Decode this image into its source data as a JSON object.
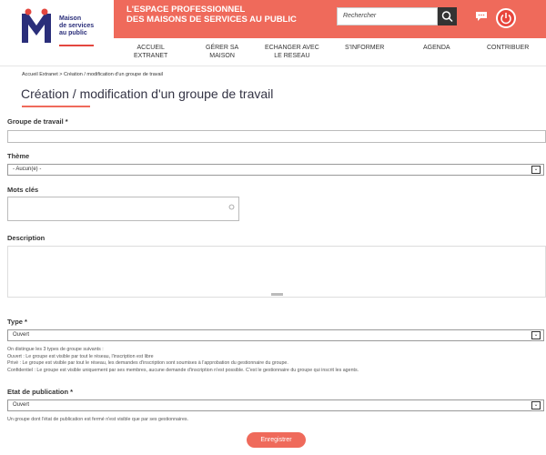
{
  "logo": {
    "lines": [
      "Maison",
      "de services",
      "au public"
    ]
  },
  "banner": {
    "title_line1": "L'ESPACE PROFESSIONNEL",
    "title_line2": "DES MAISONS DE SERVICES AU PUBLIC"
  },
  "search": {
    "placeholder": "Rechercher"
  },
  "nav": {
    "items": [
      {
        "line1": "ACCUEIL",
        "line2": "EXTRANET"
      },
      {
        "line1": "GÉRER SA",
        "line2": "MAISON"
      },
      {
        "line1": "ECHANGER AVEC",
        "line2": "LE RESEAU"
      },
      {
        "line1": "S'INFORMER",
        "line2": ""
      },
      {
        "line1": "AGENDA",
        "line2": ""
      },
      {
        "line1": "CONTRIBUER",
        "line2": ""
      }
    ]
  },
  "breadcrumb": {
    "home": "Accueil Extranet",
    "sep": " > ",
    "current": "Création / modification d'un groupe de travail"
  },
  "page": {
    "title": "Création / modification d'un groupe de travail"
  },
  "form": {
    "group_label": "Groupe de travail *",
    "group_value": "",
    "theme_label": "Thème",
    "theme_value": "- Aucun(e) -",
    "keywords_label": "Mots clés",
    "description_label": "Description",
    "type_label": "Type *",
    "type_value": "Ouvert",
    "type_help": [
      "On distingue les 3 types de groupe suivants :",
      "Ouvert : Le groupe est visible par tout le réseau, l'inscription est libre",
      "Privé : Le groupe est visible par tout le réseau, les demandes d'inscription sont soumises à l'approbation du gestionnaire du groupe.",
      "Confidentiel : Le groupe est visible uniquement par ses membres, aucune demande d'inscription n'est possible. C'est le gestionnaire du groupe qui inscrit les agents."
    ],
    "status_label": "Etat de publication *",
    "status_value": "Ouvert",
    "status_help": "Un groupe dont l'état de publication est fermé n'est visible que par ses gestionnaires.",
    "save_label": "Enregistrer"
  },
  "colors": {
    "accent": "#ef6a5b",
    "brand_blue": "#2a2e7a"
  }
}
